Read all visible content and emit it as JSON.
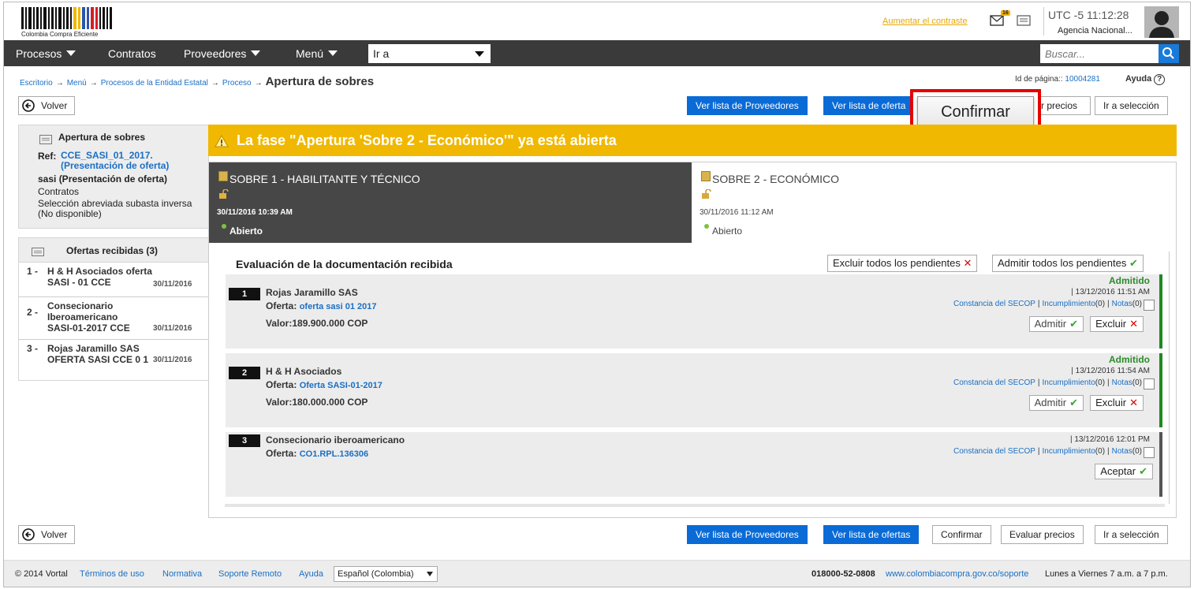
{
  "header": {
    "logo_text": "Colombia Compra Eficiente",
    "contrast_link": "Aumentar el contraste",
    "mail_badge": "16",
    "utc": "UTC -5 11:12:28",
    "agency": "Agencia Nacional..."
  },
  "nav": {
    "items": [
      "Procesos",
      "Contratos",
      "Proveedores",
      "Menú"
    ],
    "goto_label": "Ir a",
    "search_placeholder": "Buscar..."
  },
  "breadcrumb": {
    "items": [
      "Escritorio",
      "Menú",
      "Procesos de la Entidad Estatal",
      "Proceso"
    ],
    "current": "Apertura de sobres"
  },
  "page_id": {
    "label": "Id de página::",
    "value": "10004281"
  },
  "help_label": "Ayuda",
  "toolbar": {
    "back": "Volver",
    "providers": "Ver lista de Proveedores",
    "offers": "Ver lista de ofertas",
    "confirm": "Confirmar",
    "evaluate": "Evaluar precios",
    "evaluate_partial": "r precios",
    "offers_partial": "Ver lista de oferta",
    "go_selection": "Ir a selección"
  },
  "callout": {
    "label": "Confirmar",
    "color": "#e60000"
  },
  "left_panel": {
    "title": "Apertura de sobres",
    "ref_label": "Ref:",
    "ref_link": "CCE_SASI_01_2017. (Presentación de oferta)",
    "ref_name": "sasi (Presentación de oferta)",
    "contracts": "Contratos",
    "modality": "Selección abreviada subasta inversa (No disponible)",
    "offers_title": "Ofertas recibidas (3)",
    "offers": [
      {
        "num": "1 -",
        "name": "H & H Asociados oferta SASI - 01 CCE",
        "date": "30/11/2016"
      },
      {
        "num": "2 -",
        "name": "Consecionario Iberoamericano SASI-01-2017 CCE",
        "date": "30/11/2016"
      },
      {
        "num": "3 -",
        "name": "Rojas Jaramillo SAS OFERTA SASI CCE 0 1",
        "date": "30/11/2016"
      }
    ]
  },
  "warning": {
    "text": "La fase \"Apertura 'Sobre 2 - Económico'\" ya está abierta",
    "color": "#f0b800"
  },
  "envelopes": [
    {
      "title": "SOBRE 1 - HABILITANTE Y TÉCNICO",
      "date": "30/11/2016 10:39 AM",
      "status": "Abierto"
    },
    {
      "title": "SOBRE 2 - ECONÓMICO",
      "date": "30/11/2016 11:12 AM",
      "status": "Abierto"
    }
  ],
  "evaluation": {
    "title": "Evaluación de la documentación recibida",
    "exclude_all": "Excluir todos los pendientes",
    "admit_all": "Admitir todos los pendientes",
    "cards": [
      {
        "num": "1",
        "name": "Rojas Jaramillo SAS",
        "oferta_label": "Oferta:",
        "oferta": "oferta sasi 01 2017",
        "valor": "Valor:189.900.000 COP",
        "status": "Admitido",
        "time": "| 13/12/2016 11:51 AM",
        "secop": "Constancia del SECOP",
        "incump": "Incumplimiento",
        "incump_count": "(0)",
        "notas": "Notas",
        "notas_count": "(0)",
        "admit": "Admitir",
        "exclude": "Excluir"
      },
      {
        "num": "2",
        "name": "H & H Asociados",
        "oferta_label": "Oferta:",
        "oferta": "Oferta SASI-01-2017",
        "valor": "Valor:180.000.000 COP",
        "status": "Admitido",
        "time": "| 13/12/2016 11:54 AM",
        "secop": "Constancia del SECOP",
        "incump": "Incumplimiento",
        "incump_count": "(0)",
        "notas": "Notas",
        "notas_count": "(0)",
        "admit": "Admitir",
        "exclude": "Excluir"
      },
      {
        "num": "3",
        "name": "Consecionario iberoamericano",
        "oferta_label": "Oferta:",
        "oferta": "CO1.RPL.136306",
        "time": "| 13/12/2016 12:01 PM",
        "secop": "Constancia del SECOP",
        "incump": "Incumplimiento",
        "incump_count": "(0)",
        "notas": "Notas",
        "notas_count": "(0)",
        "accept": "Aceptar"
      }
    ]
  },
  "footer": {
    "copyright": "© 2014 Vortal",
    "terms": "Términos de uso",
    "normativa": "Normativa",
    "remote": "Soporte Remoto",
    "help": "Ayuda",
    "language": "Español (Colombia)",
    "phone": "018000-52-0808",
    "support_url": "www.colombiacompra.gov.co/soporte",
    "hours": "Lunes a Viernes 7 a.m. a 7 p.m."
  }
}
